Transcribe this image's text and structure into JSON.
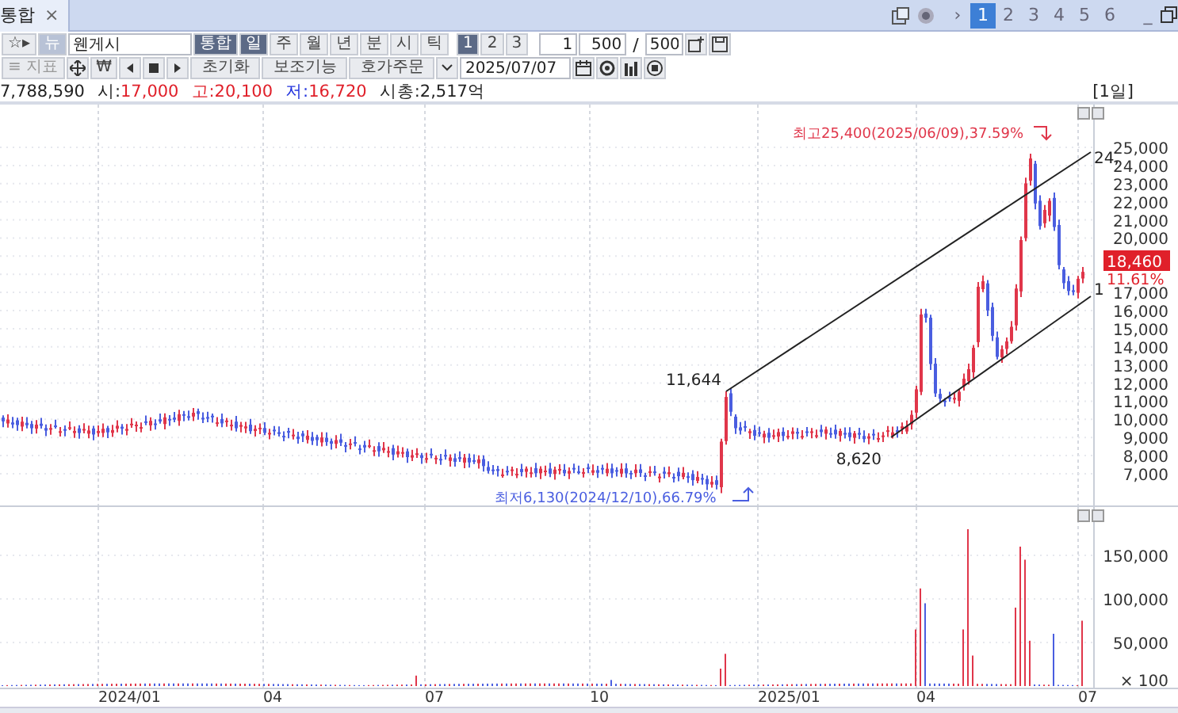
{
  "tab_bar": {
    "tabs": [
      {
        "label": "통합",
        "close": "×",
        "selected": true
      }
    ],
    "nav": "›",
    "pages": [
      {
        "label": "1",
        "selected": true
      },
      {
        "label": "2",
        "selected": false
      },
      {
        "label": "3",
        "selected": false
      },
      {
        "label": "4",
        "selected": false
      },
      {
        "label": "5",
        "selected": false
      },
      {
        "label": "6",
        "selected": false
      }
    ],
    "minimize": "_"
  },
  "toolbar": {
    "star": "☆▸",
    "news": "뉴",
    "stock_name": "웬게시",
    "merge": {
      "label": "통합",
      "selected": true
    },
    "periods": [
      {
        "label": "일",
        "selected": true
      },
      {
        "label": "주",
        "selected": false
      },
      {
        "label": "월",
        "selected": false
      },
      {
        "label": "년",
        "selected": false
      },
      {
        "label": "분",
        "selected": false
      },
      {
        "label": "시",
        "selected": false
      },
      {
        "label": "틱",
        "selected": false
      }
    ],
    "units": [
      {
        "label": "1",
        "selected": true
      },
      {
        "label": "2",
        "selected": false
      },
      {
        "label": "3",
        "selected": false
      }
    ],
    "interval": "1",
    "count": "500",
    "separator": "/",
    "total": "500"
  },
  "toolbar2": {
    "indicator": "≡ 지표",
    "won": "₩",
    "buttons": [
      "초기화",
      "보조기능",
      "호가주문"
    ],
    "date": "2025/07/07"
  },
  "info_bar": {
    "volume": "7,788,590",
    "items": [
      {
        "text": "시:",
        "color": "#222222"
      },
      {
        "text": "17,000",
        "color": "#e0202a"
      },
      {
        "text": "고:",
        "color": "#e0202a"
      },
      {
        "text": "20,100",
        "color": "#e0202a"
      },
      {
        "text": "저:",
        "color": "#2233dd"
      },
      {
        "text": "16,720",
        "color": "#e0202a"
      },
      {
        "text": "시총:",
        "color": "#222222"
      },
      {
        "text": "2,517억",
        "color": "#222222"
      }
    ],
    "period": "[1일]"
  },
  "price_chart": {
    "y_labels": [
      "25,000",
      "24,000",
      "23,000",
      "22,000",
      "21,000",
      "20,000",
      "17,000",
      "16,000",
      "15,000",
      "14,000",
      "13,000",
      "12,000",
      "11,000",
      "10,000",
      "9,000",
      "8,000",
      "7,000"
    ],
    "current_price": "18,460",
    "change": "11.61%",
    "high_note": "최고25,400(2025/06/09),37.59%",
    "low_note": "최저6,130(2024/12/10),66.79%",
    "labels": [
      {
        "text": "11,644",
        "kind": "left"
      },
      {
        "text": "8,620",
        "kind": "left"
      },
      {
        "text": "24,",
        "kind": "edge"
      },
      {
        "text": "1",
        "kind": "edge"
      }
    ]
  },
  "volume_chart": {
    "y_labels": [
      "150,000",
      "100,000",
      "50,000"
    ],
    "unit": "× 100"
  },
  "x_axis": [
    "2024/01",
    "04",
    "07",
    "10",
    "2025/01",
    "04",
    "07"
  ]
}
